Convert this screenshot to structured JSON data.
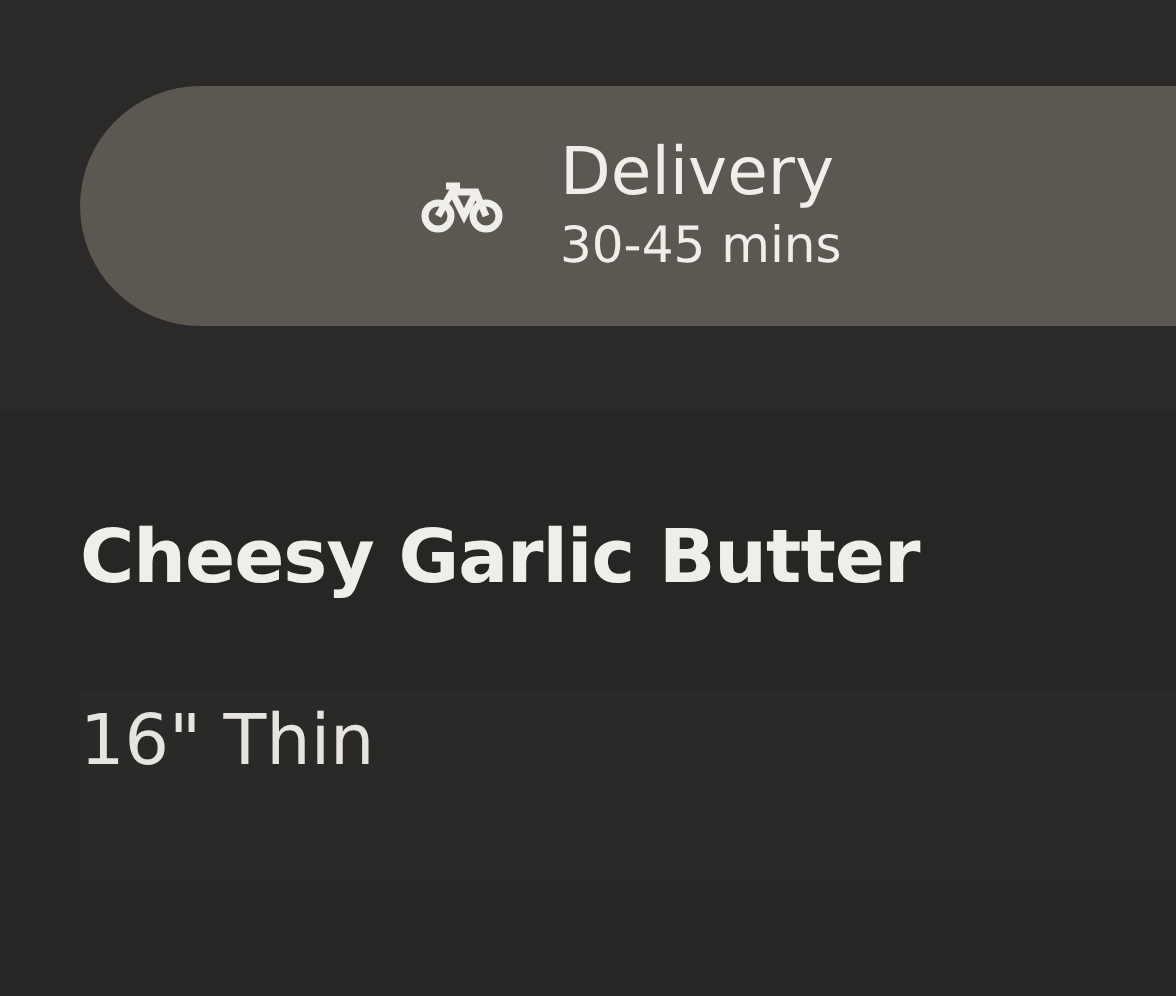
{
  "delivery": {
    "label": "Delivery",
    "time": "30-45 mins"
  },
  "item": {
    "name": "Cheesy Garlic Butter",
    "size": "16\" Thin"
  }
}
